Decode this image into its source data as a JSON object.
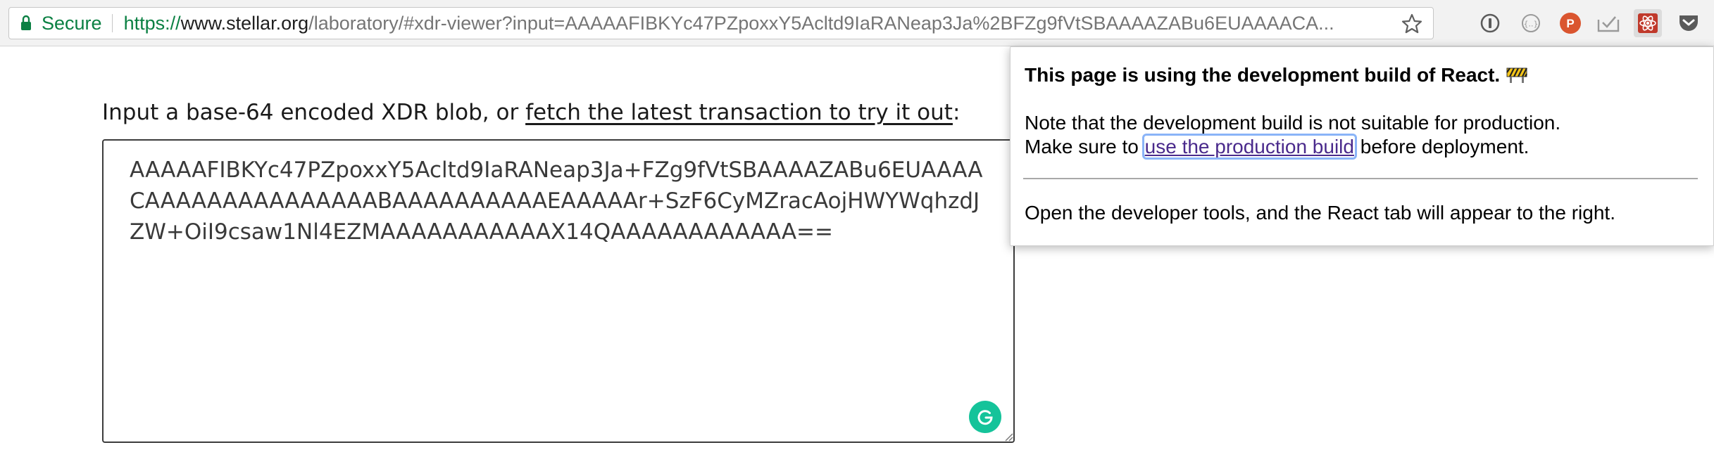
{
  "browser": {
    "secure_label": "Secure",
    "url_scheme": "https://",
    "url_host": "www.stellar.org",
    "url_rest": "/laboratory/#xdr-viewer?input=AAAAAFIBKYc47PZpoxxY5Acltd9IaRANeap3Ja%2BFZg9fVtSBAAAAZABu6EUAAAACA...",
    "extensions": [
      "1password-icon",
      "json-viewer-icon",
      "producthunt-icon",
      "todo-check-icon",
      "react-devtools-icon",
      "pocket-icon"
    ],
    "colors": {
      "secure_green": "#0b8043",
      "producthunt": "#da552f",
      "pocket_gray": "#5b5b5b"
    }
  },
  "page": {
    "input_label_prefix": "Input a base-64 encoded XDR blob, or ",
    "input_label_link": "fetch the latest transaction to try it out",
    "input_label_suffix": ":",
    "xdr_value": "AAAAAFIBKYc47PZpoxxY5Acltd9IaRANeap3Ja+FZg9fVtSBAAAAZABu6EUAAAACAAAAAAAAAAAAAAABAAAAAAAAAAEAAAAAr+SzF6CyMZracAojHWYWqhzdJZW+OiI9csaw1Nl4EZMAAAAAAAAAAAX14QAAAAAAAAAAAA==",
    "grammarly_color": "#15c39a"
  },
  "react_popup": {
    "title": "This page is using the development build of React.",
    "line1": "Note that the development build is not suitable for production.",
    "line2_prefix": "Make sure to ",
    "line2_link": "use the production build",
    "line2_suffix": " before deployment.",
    "line3": "Open the developer tools, and the React tab will appear to the right."
  }
}
